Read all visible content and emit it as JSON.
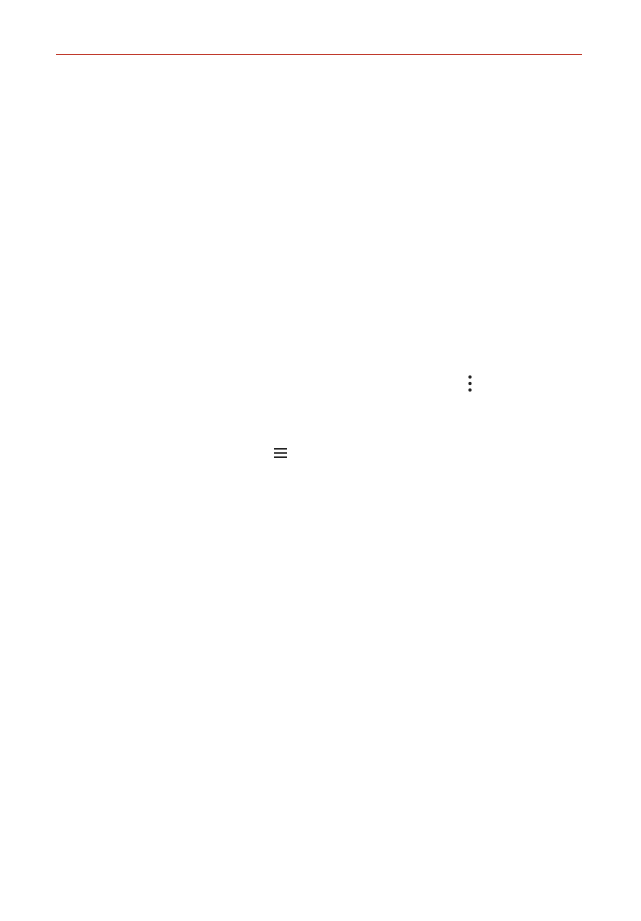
{
  "page": {
    "accent_color": "#c0392b"
  },
  "icons": {
    "overflow": "more-vert-icon",
    "menu": "hamburger-menu-icon"
  }
}
